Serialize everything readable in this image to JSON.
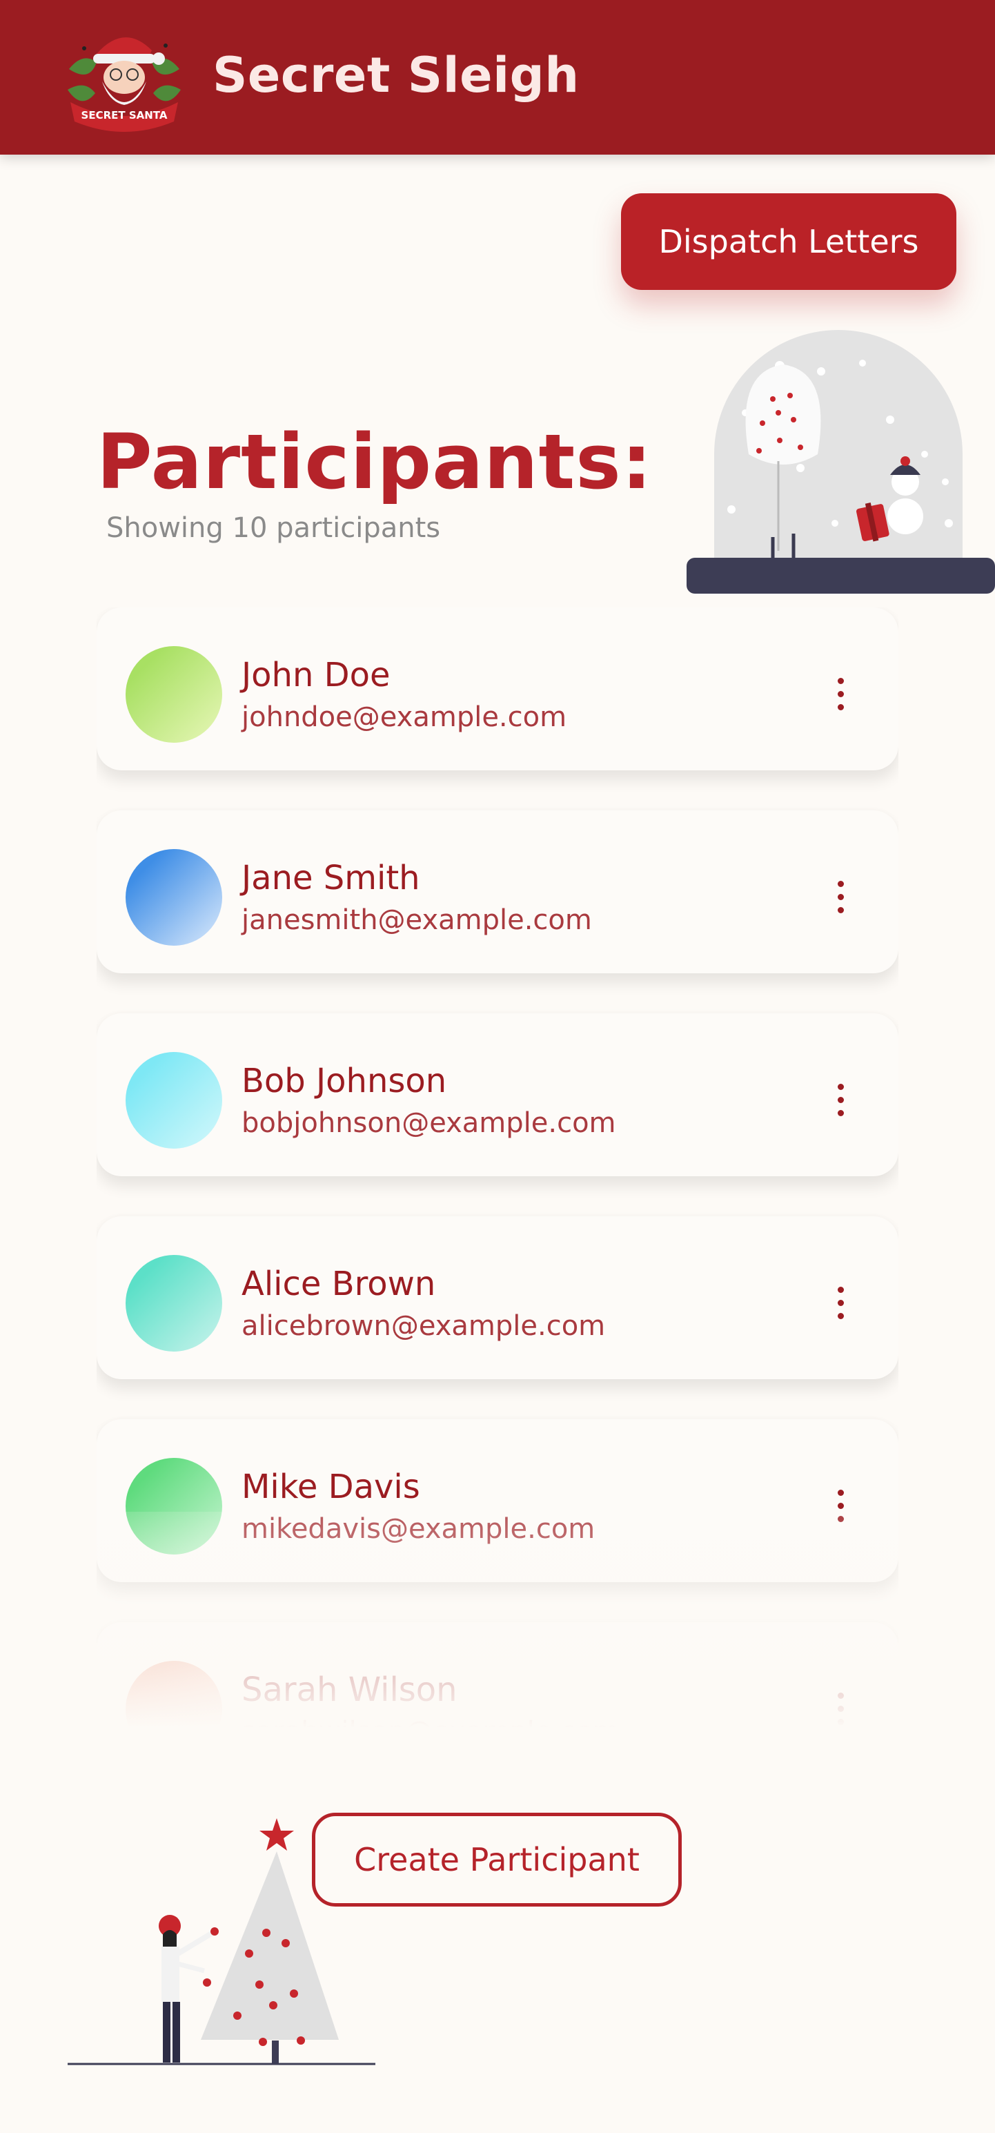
{
  "header": {
    "app_title": "Secret Sleigh",
    "logo_banner_text": "SECRET SANTA",
    "background_color": "#9b1c21"
  },
  "actions": {
    "dispatch_label": "Dispatch Letters",
    "create_label": "Create Participant"
  },
  "main": {
    "title": "Participants:",
    "count_text": "Showing 10 participants"
  },
  "participants": [
    {
      "name": "John Doe",
      "email": "johndoe@example.com",
      "avatar_colors": [
        "#a8e063",
        "#e8f7b8"
      ]
    },
    {
      "name": "Jane Smith",
      "email": "janesmith@example.com",
      "avatar_colors": [
        "#3f8ee6",
        "#dbeafc"
      ]
    },
    {
      "name": "Bob Johnson",
      "email": "bobjohnson@example.com",
      "avatar_colors": [
        "#7ee8f5",
        "#d4f8fb"
      ]
    },
    {
      "name": "Alice Brown",
      "email": "alicebrown@example.com",
      "avatar_colors": [
        "#5ce0c8",
        "#c9f3ec"
      ]
    },
    {
      "name": "Mike Davis",
      "email": "mikedavis@example.com",
      "avatar_colors": [
        "#5fdb7e",
        "#c8f5d2"
      ]
    },
    {
      "name": "Sarah Wilson",
      "email": "sarahwilson@example.com",
      "avatar_colors": [
        "#f2a890",
        "#fbe0d6"
      ]
    }
  ],
  "colors": {
    "accent": "#b5232a",
    "background": "#fdfaf6"
  },
  "icons": {
    "menu": "kebab-menu-icon"
  }
}
